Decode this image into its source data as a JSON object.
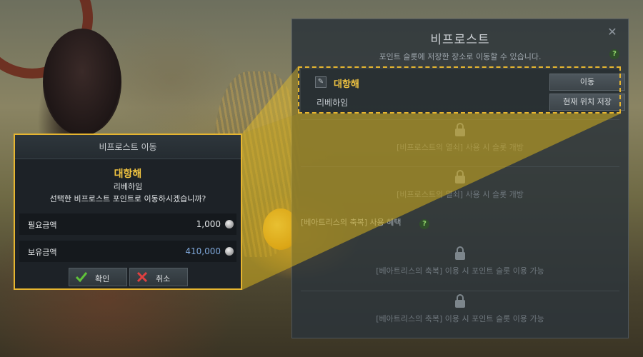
{
  "panel": {
    "title": "비프로스트",
    "close_icon": "close-icon",
    "subtitle": "포인트 슬롯에 저장한 장소로 이동할 수 있습니다.",
    "help_icon": "help-icon",
    "active_slot": {
      "name": "대항해",
      "location": "리베하임",
      "move_label": "이동",
      "save_label": "현재 위치 저장"
    },
    "locked_slots": [
      {
        "text": "[비프로스트의 열쇠] 사용 시 슬롯 개방"
      },
      {
        "text": "[비프로스트의 열쇠] 사용 시 슬롯 개방"
      }
    ],
    "blessing_header": "[베아트리스의 축복] 사용 혜택",
    "blessing_slots": [
      {
        "text": "[베아트리스의 축복] 이용 시 포인트 슬롯 이용 가능"
      },
      {
        "text": "[베아트리스의 축복] 이용 시 포인트 슬롯 이용 가능"
      }
    ]
  },
  "dialog": {
    "title": "비프로스트 이동",
    "destination": "대항해",
    "location": "리베하임",
    "question": "선택한 비프로스트 포인트로 이동하시겠습니까?",
    "required_label": "필요금액",
    "required_value": "1,000",
    "owned_label": "보유금액",
    "owned_value": "410,000",
    "confirm_label": "확인",
    "cancel_label": "취소"
  },
  "colors": {
    "accent_gold": "#f1c441",
    "highlight_border": "#e6b530",
    "owned_value": "#7ea6d8",
    "confirm_check": "#5fc23a",
    "cancel_x": "#e04040"
  }
}
